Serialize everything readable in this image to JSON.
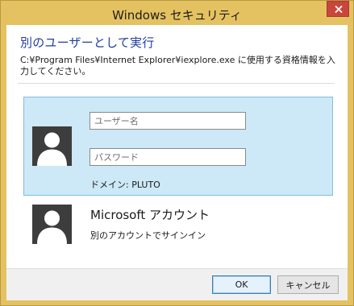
{
  "window": {
    "title": "Windows セキュリティ"
  },
  "dialog": {
    "heading": "別のユーザーとして実行",
    "description": "C:¥Program Files¥Internet Explorer¥iexplore.exe に使用する資格情報を入力してください。"
  },
  "credential_tile": {
    "username_placeholder": "ユーザー名",
    "username_value": "",
    "password_placeholder": "パスワード",
    "password_value": "",
    "domain_text": "ドメイン: PLUTO"
  },
  "microsoft_account_tile": {
    "title": "Microsoft アカウント",
    "subtitle": "別のアカウントでサインイン"
  },
  "buttons": {
    "ok_label": "OK",
    "cancel_label": "キャンセル"
  },
  "icons": {
    "close": "close-icon",
    "user_avatar": "user-silhouette-icon"
  },
  "colors": {
    "title_bar": "#e5c261",
    "heading_text": "#1f3fa0",
    "close_button": "#c9463d",
    "selected_tile": "#cde8f6",
    "selected_tile_border": "#7ebfe2",
    "avatar_background": "#3d3d3d",
    "footer": "#f0f0f0"
  }
}
